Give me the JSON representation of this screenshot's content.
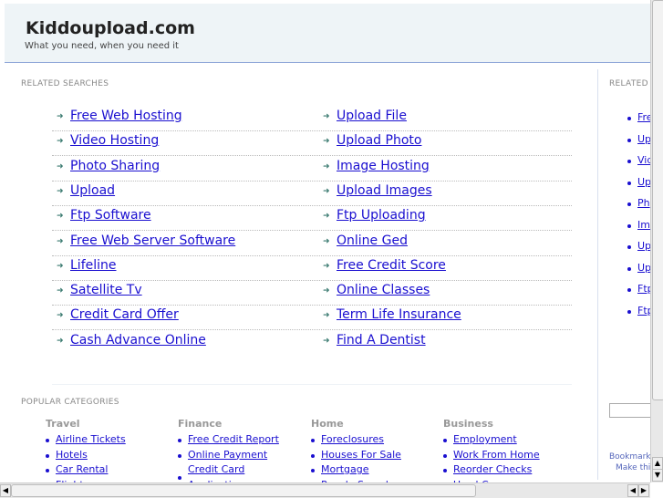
{
  "header": {
    "title": "Kiddoupload.com",
    "tagline": "What you need, when you need it"
  },
  "related": {
    "heading": "RELATED SEARCHES",
    "left": [
      "Free Web Hosting",
      "Video Hosting",
      "Photo Sharing",
      "Upload",
      "Ftp Software",
      "Free Web Server Software",
      "Lifeline",
      "Satellite Tv",
      "Credit Card Offer",
      "Cash Advance Online"
    ],
    "right": [
      "Upload File",
      "Upload Photo",
      "Image Hosting",
      "Upload Images",
      "Ftp Uploading",
      "Online Ged",
      "Free Credit Score",
      "Online Classes",
      "Term Life Insurance",
      "Find A Dentist"
    ]
  },
  "sidebar": {
    "heading": "RELATED",
    "links": [
      "Free",
      "Upl",
      "Vid",
      "Upl",
      "Ph",
      "Im",
      "Upl",
      "Upl",
      "Ftp",
      "Ftp"
    ],
    "bookmark": "Bookmark",
    "make": "Make thi"
  },
  "popular": {
    "heading": "POPULAR CATEGORIES",
    "columns": [
      {
        "title": "Travel",
        "items": [
          "Airline Tickets",
          "Hotels",
          "Car Rental",
          "Flights"
        ]
      },
      {
        "title": "Finance",
        "items": [
          "Free Credit Report",
          "Online Payment",
          "Credit Card",
          "Application"
        ]
      },
      {
        "title": "Home",
        "items": [
          "Foreclosures",
          "Houses For Sale",
          "Mortgage",
          "People Search"
        ]
      },
      {
        "title": "Business",
        "items": [
          "Employment",
          "Work From Home",
          "Reorder Checks",
          "Used Cars"
        ]
      }
    ]
  }
}
